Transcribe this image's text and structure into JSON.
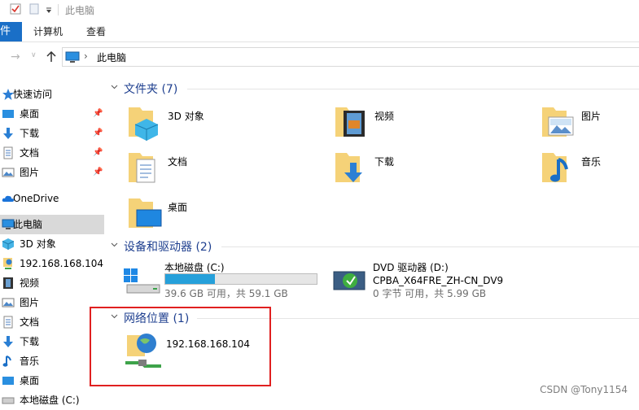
{
  "window": {
    "title": "此电脑"
  },
  "ribbon": {
    "tabs": [
      "件",
      "计算机",
      "查看"
    ]
  },
  "address": {
    "path": "此电脑"
  },
  "sidebar": {
    "items": [
      {
        "label": "快速访问",
        "icon": "star-icon",
        "pinned": false
      },
      {
        "label": "桌面",
        "icon": "desktop-icon",
        "pinned": true
      },
      {
        "label": "下载",
        "icon": "download-icon",
        "pinned": true
      },
      {
        "label": "文档",
        "icon": "document-icon",
        "pinned": true
      },
      {
        "label": "图片",
        "icon": "picture-icon",
        "pinned": true
      },
      {
        "label": "OneDrive",
        "icon": "cloud-icon",
        "pinned": false
      },
      {
        "label": "此电脑",
        "icon": "computer-icon",
        "pinned": false,
        "selected": true
      },
      {
        "label": "3D 对象",
        "icon": "cube-icon",
        "pinned": false
      },
      {
        "label": "192.168.168.104",
        "icon": "network-drive-icon",
        "pinned": false
      },
      {
        "label": "视频",
        "icon": "video-icon",
        "pinned": false
      },
      {
        "label": "图片",
        "icon": "picture-icon",
        "pinned": false
      },
      {
        "label": "文档",
        "icon": "document-icon",
        "pinned": false
      },
      {
        "label": "下载",
        "icon": "download-icon",
        "pinned": false
      },
      {
        "label": "音乐",
        "icon": "music-icon",
        "pinned": false
      },
      {
        "label": "桌面",
        "icon": "desktop-icon",
        "pinned": false
      },
      {
        "label": "本地磁盘 (C:)",
        "icon": "drive-icon",
        "pinned": false
      }
    ]
  },
  "groups": {
    "folders": {
      "title": "文件夹 (7)",
      "items": [
        {
          "label": "3D 对象",
          "icon": "cube-folder-icon"
        },
        {
          "label": "视频",
          "icon": "video-folder-icon"
        },
        {
          "label": "图片",
          "icon": "picture-folder-icon"
        },
        {
          "label": "文档",
          "icon": "document-folder-icon"
        },
        {
          "label": "下载",
          "icon": "download-folder-icon"
        },
        {
          "label": "音乐",
          "icon": "music-folder-icon"
        },
        {
          "label": "桌面",
          "icon": "desktop-folder-icon"
        }
      ]
    },
    "devices": {
      "title": "设备和驱动器 (2)",
      "items": [
        {
          "name": "本地磁盘 (C:)",
          "free": "39.6 GB 可用，共 59.1 GB",
          "used_fraction": 0.33,
          "icon": "windows-drive-icon"
        },
        {
          "name": "DVD 驱动器 (D:)",
          "sub": "CPBA_X64FRE_ZH-CN_DV9",
          "free": "0 字节 可用，共 5.99 GB",
          "icon": "dvd-drive-icon"
        }
      ]
    },
    "network": {
      "title": "网络位置 (1)",
      "items": [
        {
          "label": "192.168.168.104",
          "icon": "network-location-icon"
        }
      ]
    }
  },
  "watermark": "CSDN @Tony1154",
  "colors": {
    "accent": "#1a6fc7",
    "header": "#1e3f8f",
    "highlight": "#e02020",
    "bar": "#26a0da",
    "folder": "#f5d278"
  }
}
